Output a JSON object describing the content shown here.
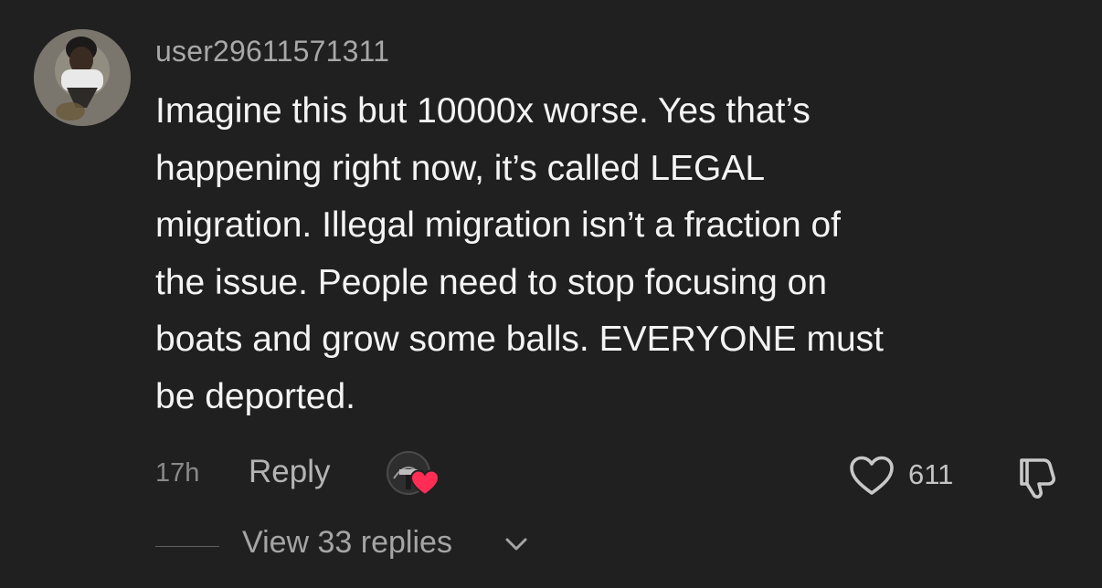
{
  "comment": {
    "username": "user29611571311",
    "text": "Imagine this but 10000x worse. Yes that’s\nhappening right now, it’s called LEGAL\nmigration. Illegal migration isn’t a fraction of\nthe issue. People need to stop focusing on\nboats and grow some balls. EVERYONE must\nbe deported.",
    "timestamp": "17h",
    "reply_label": "Reply",
    "like_count": "611",
    "view_replies_label": "View 33 replies"
  },
  "icons": {
    "like": "heart-outline-icon",
    "dislike": "thumbs-down-icon",
    "expand": "chevron-down-icon",
    "creator_liked": "creator-liked-heart-icon"
  },
  "colors": {
    "background": "#202020",
    "heart_badge": "#ff2c55"
  }
}
